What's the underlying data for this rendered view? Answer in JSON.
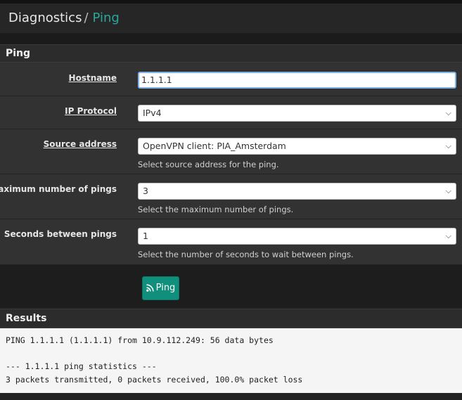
{
  "breadcrumb": {
    "section": "Diagnostics",
    "separator": "/",
    "page": "Ping"
  },
  "form": {
    "title": "Ping",
    "hostname": {
      "label": "Hostname",
      "value": "1.1.1.1"
    },
    "ip_protocol": {
      "label": "IP Protocol",
      "value": "IPv4"
    },
    "source_address": {
      "label": "Source address",
      "value": "OpenVPN client: PIA_Amsterdam",
      "help": "Select source address for the ping."
    },
    "max_pings": {
      "label": "Maximum number of pings",
      "value": "3",
      "help": "Select the maximum number of pings."
    },
    "seconds_between": {
      "label": "Seconds between pings",
      "value": "1",
      "help": "Select the number of seconds to wait between pings."
    },
    "submit_label": "Ping",
    "submit_icon": "rss-icon",
    "accent_color": "#0f8f7c"
  },
  "results": {
    "title": "Results",
    "lines": [
      "PING 1.1.1.1 (1.1.1.1) from 10.9.112.249: 56 data bytes",
      "",
      "--- 1.1.1.1 ping statistics ---",
      "3 packets transmitted, 0 packets received, 100.0% packet loss"
    ]
  }
}
